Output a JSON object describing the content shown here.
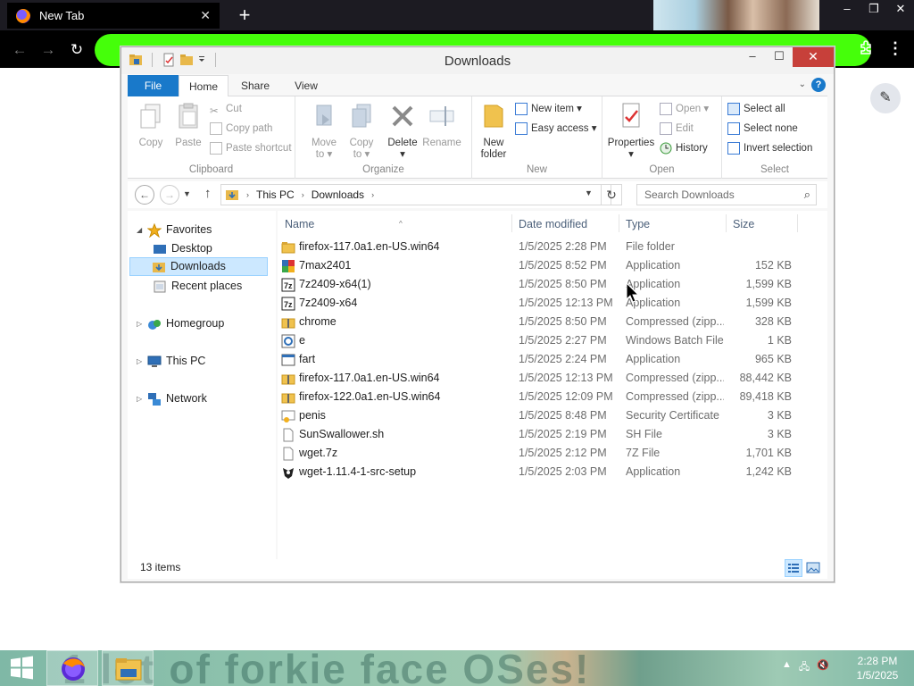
{
  "browser": {
    "tab_title": "New Tab",
    "tab_close": "✕",
    "new_tab": "+",
    "back": "←",
    "forward": "→",
    "reload": "↻",
    "menu": "⋮",
    "edit": "✎",
    "minimize": "–",
    "maximize": "❐",
    "close": "✕"
  },
  "window": {
    "title": "Downloads",
    "minimize": "–",
    "maximize": "☐",
    "close": "✕"
  },
  "ribbon_tabs": {
    "file": "File",
    "home": "Home",
    "share": "Share",
    "view": "View",
    "help": "?"
  },
  "ribbon": {
    "clipboard": {
      "label": "Clipboard",
      "copy": "Copy",
      "paste": "Paste",
      "cut": "Cut",
      "copy_path": "Copy path",
      "paste_shortcut": "Paste shortcut"
    },
    "organize": {
      "label": "Organize",
      "move_to_1": "Move",
      "move_to_2": "to ▾",
      "copy_to_1": "Copy",
      "copy_to_2": "to ▾",
      "delete_1": "Delete",
      "delete_2": "▾",
      "rename": "Rename"
    },
    "new": {
      "label": "New",
      "new_folder_1": "New",
      "new_folder_2": "folder",
      "new_item": "New item ▾",
      "easy_access": "Easy access ▾"
    },
    "open": {
      "label": "Open",
      "properties_1": "Properties",
      "properties_2": "▾",
      "open": "Open ▾",
      "edit": "Edit",
      "history": "History"
    },
    "select": {
      "label": "Select",
      "select_all": "Select all",
      "select_none": "Select none",
      "invert": "Invert selection"
    }
  },
  "address": {
    "crumb_1": "This PC",
    "crumb_2": "Downloads",
    "sep": "›",
    "search_placeholder": "Search Downloads"
  },
  "nav": {
    "favorites": "Favorites",
    "desktop": "Desktop",
    "downloads": "Downloads",
    "recent": "Recent places",
    "homegroup": "Homegroup",
    "this_pc": "This PC",
    "network": "Network"
  },
  "columns": {
    "name": "Name",
    "date": "Date modified",
    "type": "Type",
    "size": "Size"
  },
  "files": [
    {
      "name": "firefox-117.0a1.en-US.win64",
      "date": "1/5/2025 2:28 PM",
      "type": "File folder",
      "size": "",
      "icon": "folder"
    },
    {
      "name": "7max2401",
      "date": "1/5/2025 8:52 PM",
      "type": "Application",
      "size": "152 KB",
      "icon": "app-7max"
    },
    {
      "name": "7z2409-x64(1)",
      "date": "1/5/2025 8:50 PM",
      "type": "Application",
      "size": "1,599 KB",
      "icon": "app-7z"
    },
    {
      "name": "7z2409-x64",
      "date": "1/5/2025 12:13 PM",
      "type": "Application",
      "size": "1,599 KB",
      "icon": "app-7z"
    },
    {
      "name": "chrome",
      "date": "1/5/2025 8:50 PM",
      "type": "Compressed (zipp...",
      "size": "328 KB",
      "icon": "zip"
    },
    {
      "name": "e",
      "date": "1/5/2025 2:27 PM",
      "type": "Windows Batch File",
      "size": "1 KB",
      "icon": "batch"
    },
    {
      "name": "fart",
      "date": "1/5/2025 2:24 PM",
      "type": "Application",
      "size": "965 KB",
      "icon": "app"
    },
    {
      "name": "firefox-117.0a1.en-US.win64",
      "date": "1/5/2025 12:13 PM",
      "type": "Compressed (zipp...",
      "size": "88,442 KB",
      "icon": "zip"
    },
    {
      "name": "firefox-122.0a1.en-US.win64",
      "date": "1/5/2025 12:09 PM",
      "type": "Compressed (zipp...",
      "size": "89,418 KB",
      "icon": "zip"
    },
    {
      "name": "penis",
      "date": "1/5/2025 8:48 PM",
      "type": "Security Certificate",
      "size": "3 KB",
      "icon": "cert"
    },
    {
      "name": "SunSwallower.sh",
      "date": "1/5/2025 2:19 PM",
      "type": "SH File",
      "size": "3 KB",
      "icon": "file"
    },
    {
      "name": "wget.7z",
      "date": "1/5/2025 2:12 PM",
      "type": "7Z File",
      "size": "1,701 KB",
      "icon": "file"
    },
    {
      "name": "wget-1.11.4-1-src-setup",
      "date": "1/5/2025 2:03 PM",
      "type": "Application",
      "size": "1,242 KB",
      "icon": "app-setup"
    }
  ],
  "status": {
    "items": "13 items"
  },
  "taskbar": {
    "banner": "1 lot of forkie face  OSes!",
    "time": "2:28 PM",
    "date": "1/5/2025"
  },
  "colors": {
    "accent": "#1979ca",
    "url_bar": "#45ff0a",
    "selection": "#cce8ff",
    "close_red": "#c7403a"
  }
}
